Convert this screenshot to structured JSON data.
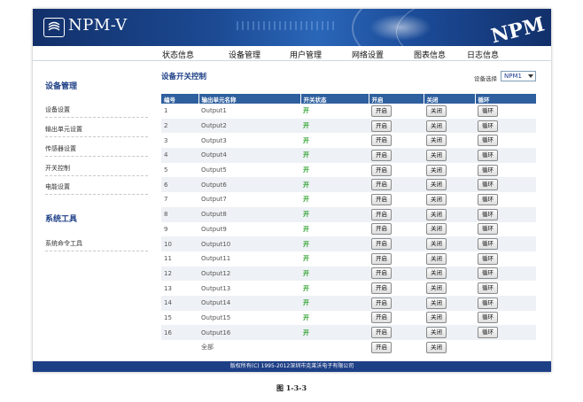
{
  "header": {
    "brand": "NPM-V",
    "brand_right": "NPM",
    "logo_icon": "npm-logo-icon"
  },
  "nav": {
    "items": [
      "状态信息",
      "设备管理",
      "用户管理",
      "网络设置",
      "图表信息",
      "日志信息"
    ]
  },
  "sidebar": {
    "sections": [
      {
        "title": "设备管理",
        "items": [
          "设备设置",
          "输出单元设置",
          "传感器设置",
          "开关控制",
          "电能设置"
        ]
      },
      {
        "title": "系统工具",
        "items": [
          "系统命令工具"
        ]
      }
    ]
  },
  "main": {
    "title": "设备开关控制",
    "device_label": "设备选择",
    "device_selected": "NPM1",
    "columns": [
      "编号",
      "输出单元名称",
      "开关状态",
      "开启",
      "关闭",
      "循环"
    ],
    "rows": [
      {
        "id": "1",
        "name": "Output1",
        "state": "开"
      },
      {
        "id": "2",
        "name": "Output2",
        "state": "开"
      },
      {
        "id": "3",
        "name": "Output3",
        "state": "开"
      },
      {
        "id": "4",
        "name": "Output4",
        "state": "开"
      },
      {
        "id": "5",
        "name": "Output5",
        "state": "开"
      },
      {
        "id": "6",
        "name": "Output6",
        "state": "开"
      },
      {
        "id": "7",
        "name": "Output7",
        "state": "开"
      },
      {
        "id": "8",
        "name": "Output8",
        "state": "开"
      },
      {
        "id": "9",
        "name": "Output9",
        "state": "开"
      },
      {
        "id": "10",
        "name": "Output10",
        "state": "开"
      },
      {
        "id": "11",
        "name": "Output11",
        "state": "开"
      },
      {
        "id": "12",
        "name": "Output12",
        "state": "开"
      },
      {
        "id": "13",
        "name": "Output13",
        "state": "开"
      },
      {
        "id": "14",
        "name": "Output14",
        "state": "开"
      },
      {
        "id": "15",
        "name": "Output15",
        "state": "开"
      },
      {
        "id": "16",
        "name": "Output16",
        "state": "开"
      }
    ],
    "all_row_label": "全部",
    "btn_on": "开启",
    "btn_off": "关闭",
    "btn_cycle": "循环"
  },
  "footer": {
    "text": "版权所有(C) 1995-2012深圳市克莱沃电子有限公司"
  },
  "caption": "图 1-3-3",
  "colors": {
    "header": "#1c4a93",
    "table_header": "#2e5f9e",
    "state_on": "#2aa02a",
    "footer": "#1d3f86"
  }
}
